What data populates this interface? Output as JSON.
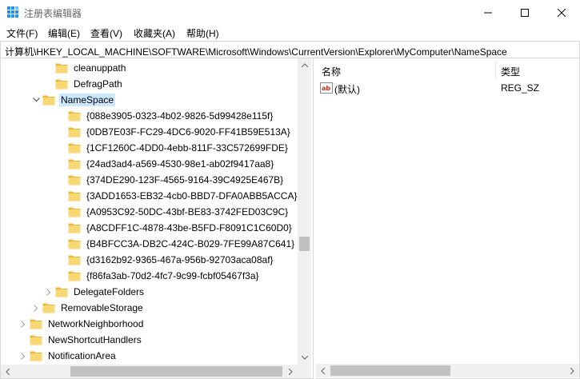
{
  "window": {
    "title": "注册表编辑器",
    "icon": "registry-editor-icon"
  },
  "menu": {
    "file": "文件(F)",
    "edit": "编辑(E)",
    "view": "查看(V)",
    "favorites": "收藏夹(A)",
    "help": "帮助(H)"
  },
  "address": {
    "path": "计算机\\HKEY_LOCAL_MACHINE\\SOFTWARE\\Microsoft\\Windows\\CurrentVersion\\Explorer\\MyComputer\\NameSpace"
  },
  "tree": {
    "items": [
      {
        "label": "cleanuppath",
        "expander": ""
      },
      {
        "label": "DefragPath",
        "expander": ""
      },
      {
        "label": "NameSpace",
        "expander": "expanded",
        "selected": true
      },
      {
        "label": "{088e3905-0323-4b02-9826-5d99428e115f}",
        "expander": ""
      },
      {
        "label": "{0DB7E03F-FC29-4DC6-9020-FF41B59E513A}",
        "expander": ""
      },
      {
        "label": "{1CF1260C-4DD0-4ebb-811F-33C572699FDE}",
        "expander": ""
      },
      {
        "label": "{24ad3ad4-a569-4530-98e1-ab02f9417aa8}",
        "expander": ""
      },
      {
        "label": "{374DE290-123F-4565-9164-39C4925E467B}",
        "expander": ""
      },
      {
        "label": "{3ADD1653-EB32-4cb0-BBD7-DFA0ABB5ACCA}",
        "expander": ""
      },
      {
        "label": "{A0953C92-50DC-43bf-BE83-3742FED03C9C}",
        "expander": ""
      },
      {
        "label": "{A8CDFF1C-4878-43be-B5FD-F8091C1C60D0}",
        "expander": ""
      },
      {
        "label": "{B4BFCC3A-DB2C-424C-B029-7FE99A87C641}",
        "expander": ""
      },
      {
        "label": "{d3162b92-9365-467a-956b-92703aca08af}",
        "expander": ""
      },
      {
        "label": "{f86fa3ab-70d2-4fc7-9c99-fcbf05467f3a}",
        "expander": ""
      },
      {
        "label": "DelegateFolders",
        "expander": "collapsed"
      },
      {
        "label": "RemovableStorage",
        "expander": "collapsed"
      },
      {
        "label": "NetworkNeighborhood",
        "expander": "collapsed"
      },
      {
        "label": "NewShortcutHandlers",
        "expander": ""
      },
      {
        "label": "NotificationArea",
        "expander": "collapsed"
      }
    ]
  },
  "list": {
    "columns": {
      "name": "名称",
      "type": "类型"
    },
    "rows": [
      {
        "name": "(默认)",
        "type": "REG_SZ",
        "icon": "string-value-icon"
      }
    ]
  },
  "colors": {
    "selection": "#cce8ff",
    "folder": "#f8d775",
    "folder_dark": "#e8b93a",
    "scroll_thumb": "#c1c1c1",
    "scroll_track": "#f0f0f0",
    "border": "#d9d9d9",
    "string_icon_red": "#c42b1c"
  }
}
